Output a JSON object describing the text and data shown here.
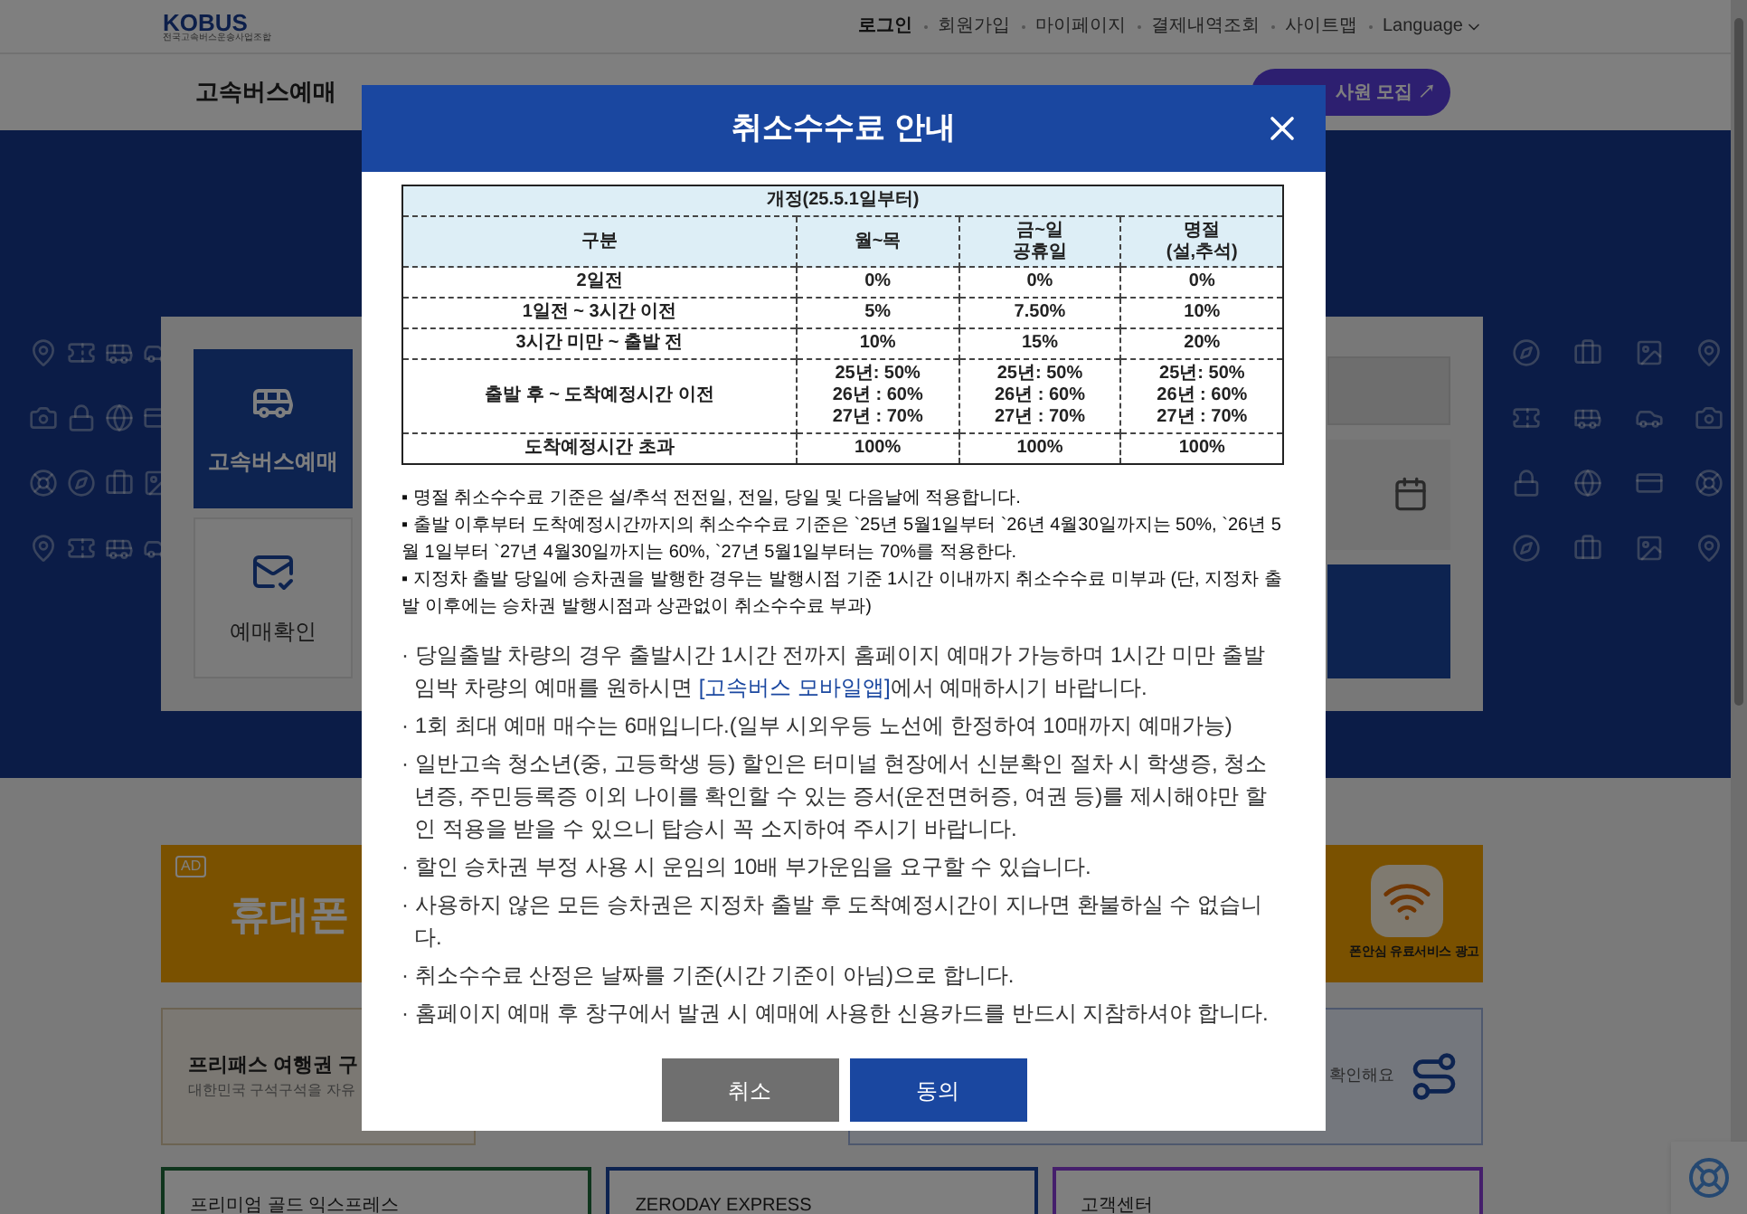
{
  "header": {
    "logo": {
      "name": "KOBUS",
      "subtitle": "전국고속버스운송사업조합"
    },
    "links": [
      "로그인",
      "회원가입",
      "마이페이지",
      "결제내역조회",
      "사이트맵"
    ],
    "language": "Language"
  },
  "nav": {
    "items": [
      "고속버스예매"
    ],
    "recruit_button": "사원 모집 ↗"
  },
  "booking_panel": {
    "tabs": [
      {
        "label": "고속버스예매",
        "selected": true
      },
      {
        "label": "예매확인",
        "selected": false
      }
    ]
  },
  "ad_banner": {
    "badge": "AD",
    "headline": "휴대폰",
    "caption": "폰안심 유료서비스 광고"
  },
  "cards": [
    {
      "title": "프리패스 여행권 구",
      "subtitle": "대한민국 구석구석을 자유"
    },
    {
      "subtitle": "확인해요"
    }
  ],
  "bottom_cards": [
    "프리미엄 골드 익스프레스",
    "ZERODAY EXPRESS",
    "고객센터"
  ],
  "modal": {
    "title": "취소수수료 안내",
    "table": {
      "caption": "개정(25.5.1일부터)",
      "columns": [
        "구분",
        "월~목",
        "금~일\n공휴일",
        "명절\n(설,추석)"
      ],
      "rows": [
        [
          "2일전",
          "0%",
          "0%",
          "0%"
        ],
        [
          "1일전 ~ 3시간 이전",
          "5%",
          "7.50%",
          "10%"
        ],
        [
          "3시간 미만 ~ 출발 전",
          "10%",
          "15%",
          "20%"
        ],
        [
          "출발 후 ~ 도착예정시간 이전",
          "25년: 50%\n26년 : 60%\n27년 : 70%",
          "25년: 50%\n26년 : 60%\n27년 : 70%",
          "25년: 50%\n26년 : 60%\n27년 : 70%"
        ],
        [
          "도착예정시간 초과",
          "100%",
          "100%",
          "100%"
        ]
      ]
    },
    "notes": [
      "▪ 명절 취소수수료 기준은 설/추석 전전일, 전일, 당일 및 다음날에 적용합니다.",
      "▪ 출발 이후부터 도착예정시간까지의 취소수수료 기준은 `25년 5월1일부터 `26년 4월30일까지는 50%, `26년 5월 1일부터 `27년 4월30일까지는 60%, `27년 5월1일부터는 70%를 적용한다.",
      "▪ 지정차 출발 당일에 승차권을 발행한 경우는 발행시점 기준 1시간 이내까지 취소수수료 미부과 (단, 지정차 출발 이후에는 승차권 발행시점과 상관없이 취소수수료 부과)"
    ],
    "bullets": [
      {
        "text": "· 당일출발 차량의 경우 출발시간 1시간 전까지 홈페이지 예매가 가능하며 1시간 미만 출발임박 차량의 예매를 원하시면 ",
        "link": "[고속버스 모바일앱]",
        "after": "에서 예매하시기 바랍니다."
      },
      {
        "text": "· 1회 최대 예매 매수는 6매입니다.(일부 시외우등 노선에 한정하여 10매까지 예매가능)"
      },
      {
        "text": "· 일반고속 청소년(중, 고등학생 등) 할인은 터미널 현장에서 신분확인 절차 시 학생증, 청소년증, 주민등록증 이외 나이를 확인할 수 있는 증서(운전면허증, 여권 등)를 제시해야만 할인 적용을 받을 수 있으니 탑승시 꼭 소지하여 주시기 바랍니다."
      },
      {
        "text": "· 할인 승차권 부정 사용 시 운임의 10배 부가운임을 요구할 수 있습니다."
      },
      {
        "text": "· 사용하지 않은 모든 승차권은 지정차 출발 후 도착예정시간이 지나면 환불하실 수 없습니다."
      },
      {
        "text": "· 취소수수료 산정은 날짜를 기준(시간 기준이 아님)으로 합니다."
      },
      {
        "text": "· 홈페이지 예매 후 창구에서 발권 시 예매에 사용한 신용카드를 반드시 지참하셔야 합니다."
      }
    ],
    "buttons": [
      {
        "label": "취소",
        "kind": "cancel"
      },
      {
        "label": "동의",
        "kind": "confirm"
      }
    ]
  }
}
